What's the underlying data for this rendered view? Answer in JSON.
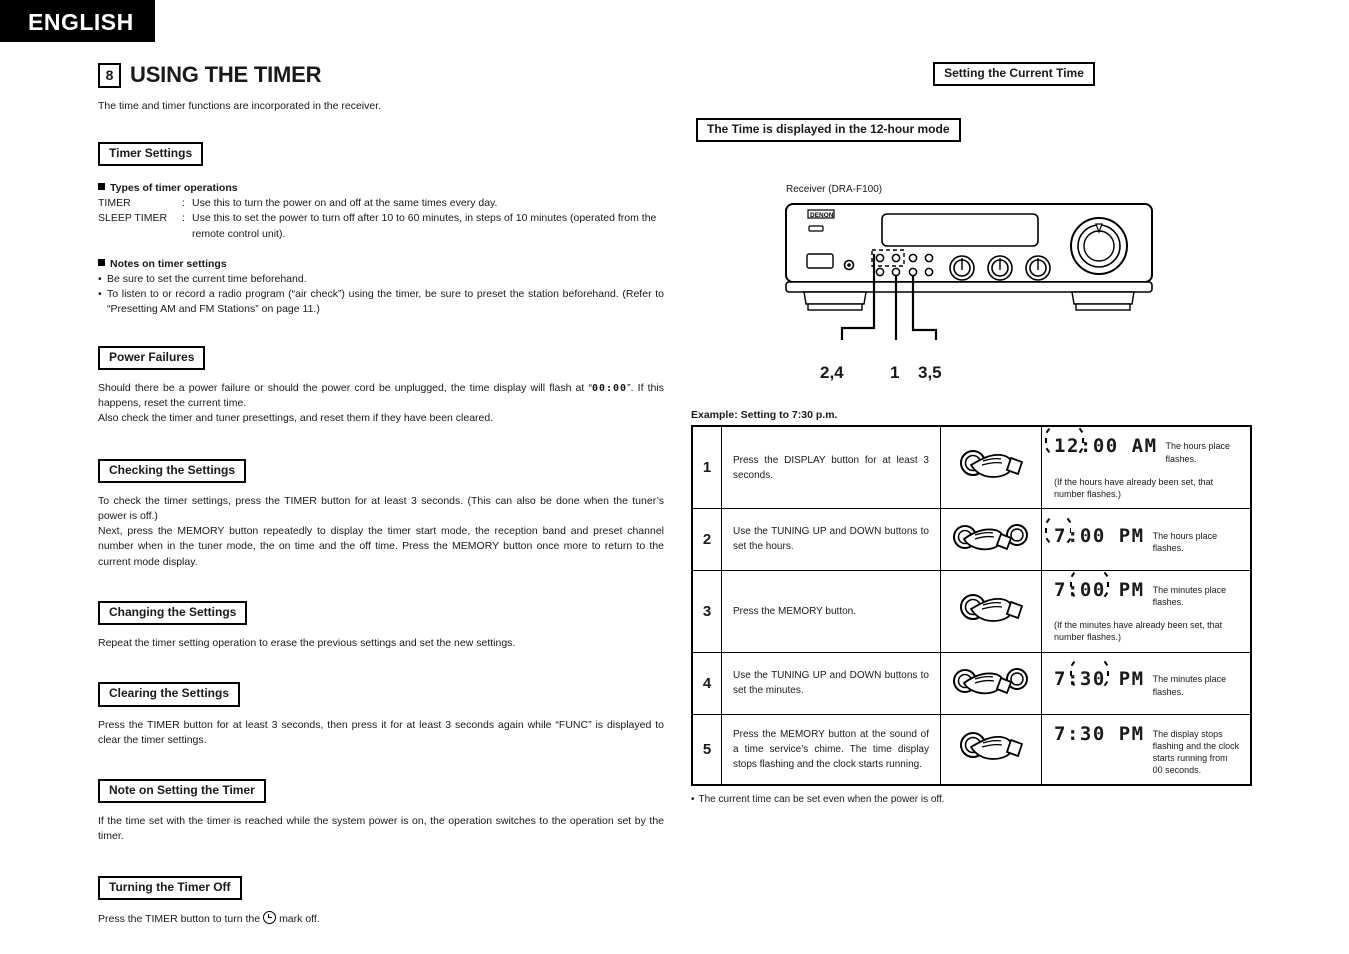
{
  "language_banner": "ENGLISH",
  "chapter": {
    "number": "8",
    "title": "USING THE TIMER",
    "intro": "The time and timer functions are incorporated in the receiver."
  },
  "left_column": {
    "timer_settings": {
      "heading": "Timer Settings",
      "types_subhead": "Types of timer operations",
      "types": [
        {
          "term": "TIMER",
          "colon": ":",
          "desc": "Use this to turn the power on and off at the same times every day."
        },
        {
          "term": "SLEEP TIMER",
          "colon": ":",
          "desc": "Use this to set the power to turn off after 10 to 60 minutes, in steps of 10 minutes (operated from the",
          "cont": "remote control unit)."
        }
      ],
      "notes_subhead": "Notes on timer settings",
      "notes": [
        "Be sure to set the current time beforehand.",
        "To listen to or record a radio program (“air check”) using the timer, be sure to preset the station beforehand. (Refer to “Presetting AM and FM Stations” on page 11.)"
      ]
    },
    "power_failures": {
      "heading": "Power Failures",
      "text_before": "Should there be a power failure or should the power cord be unplugged, the time display will flash at “",
      "lcd_value": "00:00",
      "text_after": "”. If this happens, reset the current time.",
      "text_line2": "Also check the timer and tuner presettings, and reset them if they have been cleared."
    },
    "checking_settings": {
      "heading": "Checking the Settings",
      "paragraph1": "To check the timer settings, press the TIMER button for at least 3 seconds. (This can also be done when the tuner’s power is off.)",
      "paragraph2": "Next, press the MEMORY button repeatedly to display the timer start mode, the reception band and preset channel number when in the tuner mode, the on time and the off time. Press the MEMORY button once more to return to the current mode display."
    },
    "changing_settings": {
      "heading": "Changing the Settings",
      "paragraph": "Repeat the timer setting operation to erase the previous settings and set the new settings."
    },
    "clearing_settings": {
      "heading": "Clearing the Settings",
      "paragraph": "Press the TIMER button for at least 3 seconds, then press it for at least 3 seconds again while “FUNC” is displayed to clear the timer settings."
    },
    "note_on_setting": {
      "heading": "Note on Setting the Timer",
      "paragraph": "If the time set with the timer is reached while the system power is on, the operation switches to the operation set by the timer."
    },
    "turning_off": {
      "heading": "Turning the Timer Off",
      "text_before": "Press the TIMER button to turn the",
      "text_after": "mark off."
    }
  },
  "right_column": {
    "section_heading": "Setting the Current Time",
    "mode_heading": "The Time is displayed in the 12-hour mode",
    "receiver_label": "Receiver (DRA-F100)",
    "receiver_brand": "DENON",
    "callouts": [
      {
        "label": "2,4"
      },
      {
        "label": "1"
      },
      {
        "label": "3,5"
      }
    ],
    "example_label": "Example: Setting to 7:30 p.m.",
    "steps": [
      {
        "num": "1",
        "instruction": "Press the DISPLAY button for at least 3 seconds.",
        "icon": "hand-press-single-button-icon",
        "display": "12:00 AM",
        "display_note": "The hours place flashes.",
        "display_sub": "(If the hours have already been set, that number flashes.)",
        "flash_target": "hours"
      },
      {
        "num": "2",
        "instruction": "Use the TUNING UP and DOWN buttons to set the hours.",
        "icon": "hand-press-two-buttons-icon",
        "display": "7:00 PM",
        "display_note": "The hours place flashes.",
        "display_sub": "",
        "flash_target": "hours"
      },
      {
        "num": "3",
        "instruction": "Press the MEMORY button.",
        "icon": "hand-press-single-button-icon",
        "display": "7:00 PM",
        "display_note": "The minutes place flashes.",
        "display_sub": "(If the minutes have already been set, that number flashes.)",
        "flash_target": "minutes"
      },
      {
        "num": "4",
        "instruction": "Use the TUNING UP and DOWN buttons to set the minutes.",
        "icon": "hand-press-two-buttons-icon",
        "display": "7:30 PM",
        "display_note": "The minutes place flashes.",
        "display_sub": "",
        "flash_target": "minutes"
      },
      {
        "num": "5",
        "instruction": "Press the MEMORY button at the sound of a time service’s chime. The time display stops flashing and the clock starts running.",
        "icon": "hand-press-single-button-icon",
        "display": "7:30 PM",
        "display_note": "The display stops flashing and the clock starts running from 00 seconds.",
        "display_sub": "",
        "flash_target": "none"
      }
    ],
    "footnote": "The current time can be set even when the power is off."
  }
}
